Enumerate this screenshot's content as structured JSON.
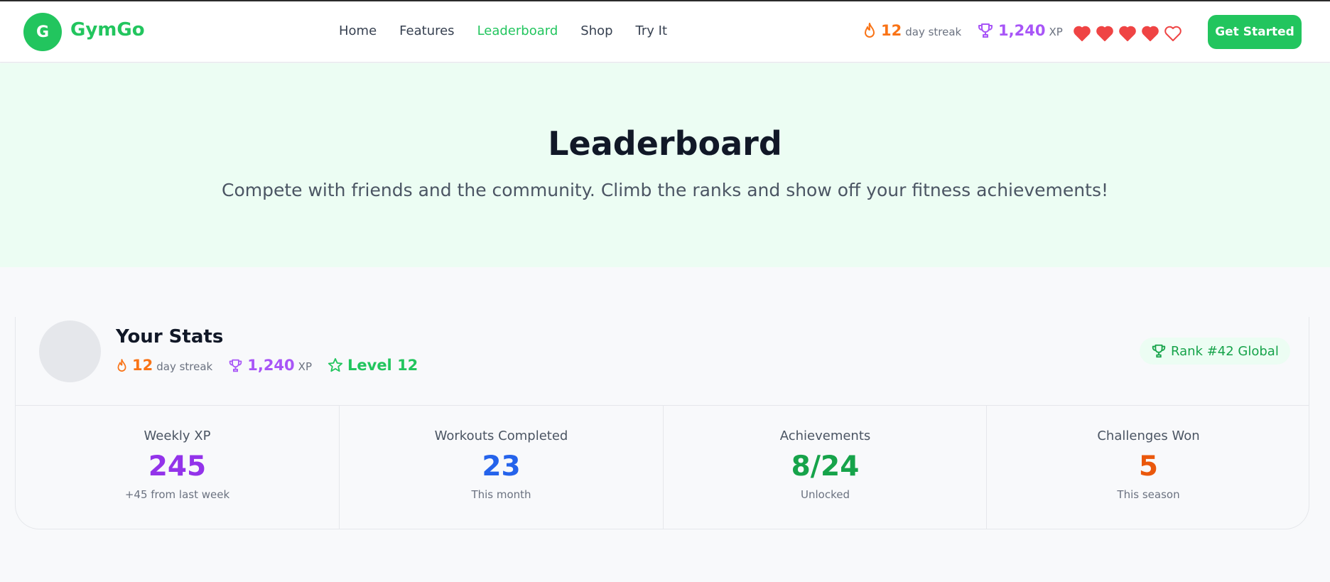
{
  "brand": {
    "initial": "G",
    "name": "GymGo"
  },
  "nav": {
    "links": [
      {
        "label": "Home"
      },
      {
        "label": "Features"
      },
      {
        "label": "Leaderboard",
        "active": true
      },
      {
        "label": "Shop"
      },
      {
        "label": "Try It"
      }
    ],
    "streak_value": "12",
    "streak_label": "day streak",
    "xp_value": "1,240",
    "xp_label": "XP",
    "hearts": {
      "filled": 4,
      "total": 5
    },
    "cta_label": "Get Started"
  },
  "hero": {
    "title": "Leaderboard",
    "subtitle": "Compete with friends and the community. Climb the ranks and show off your fitness achievements!"
  },
  "stats": {
    "title": "Your Stats",
    "streak_value": "12",
    "streak_label": "day streak",
    "xp_value": "1,240",
    "xp_label": "XP",
    "level_label": "Level 12",
    "rank_label": "Rank #42 Global",
    "columns": [
      {
        "label": "Weekly XP",
        "value": "245",
        "note": "+45 from last week",
        "color": "#9333ea"
      },
      {
        "label": "Workouts Completed",
        "value": "23",
        "note": "This month",
        "color": "#2563eb"
      },
      {
        "label": "Achievements",
        "value": "8/24",
        "note": "Unlocked",
        "color": "#16a34a"
      },
      {
        "label": "Challenges Won",
        "value": "5",
        "note": "This season",
        "color": "#ea580c"
      }
    ]
  },
  "colors": {
    "brand_green": "#22c55e",
    "streak_orange": "#f97316",
    "xp_purple": "#a855f7",
    "heart_red": "#ef4444",
    "hero_bg": "#ecfdf3"
  }
}
